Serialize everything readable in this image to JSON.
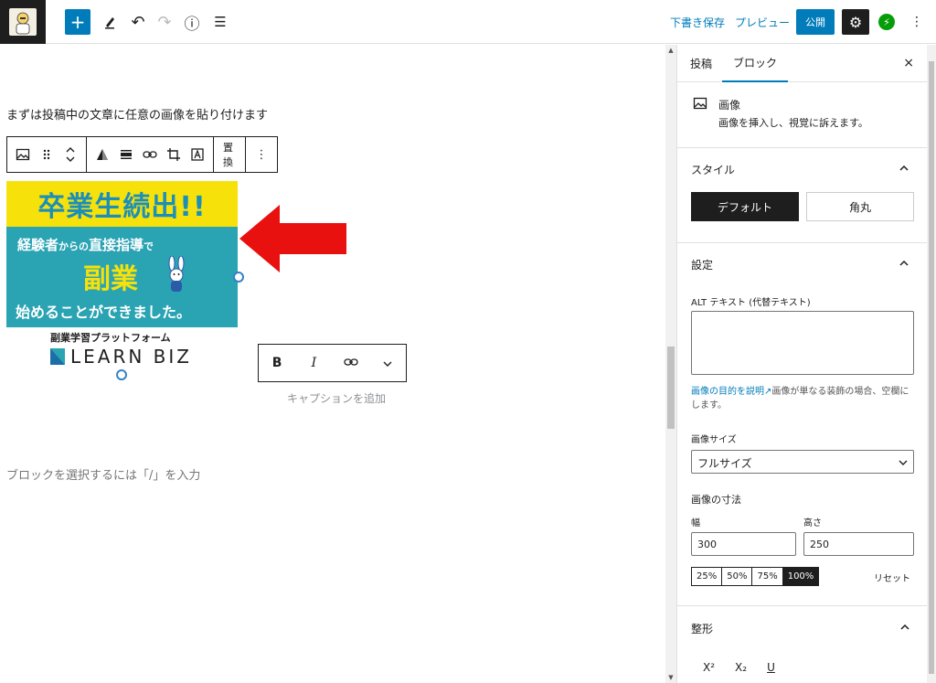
{
  "topbar": {
    "draft_save": "下書き保存",
    "preview": "プレビュー",
    "publish": "公開",
    "inserter_symbol": "+",
    "undo_symbol": "↶",
    "redo_symbol": "↷",
    "info_symbol": "ⓘ",
    "outline_symbol": "☰",
    "more_symbol": "⋮",
    "gear_symbol": "⚙",
    "jetpack_symbol": "⚡"
  },
  "editor": {
    "paragraph": "まずは投稿中の文章に任意の画像を貼り付けます",
    "replace_label": "置換",
    "caption_placeholder": "キャプションを追加",
    "appender_placeholder": "ブロックを選択するには「/」を入力",
    "format": {
      "bold": "B",
      "italic": "I",
      "link": "⊝",
      "more": "⌄"
    },
    "banner": {
      "headline": "卒業生続出!!",
      "line1_a": "経験者",
      "line1_b": "からの",
      "line1_c": "直接指導",
      "line1_d": "で",
      "line2": "副業",
      "line3": "始めることができました。",
      "sub": "副業学習プラットフォーム",
      "brand": "LEARN BIZ"
    }
  },
  "sidebar": {
    "tab_post": "投稿",
    "tab_block": "ブロック",
    "close": "×",
    "block_title": "画像",
    "block_desc": "画像を挿入し、視覚に訴えます。",
    "styles_title": "スタイル",
    "style_default": "デフォルト",
    "style_rounded": "角丸",
    "settings_title": "設定",
    "alt_label": "ALT テキスト (代替テキスト)",
    "help_link": "画像の目的を説明",
    "help_text": "画像が単なる装飾の場合、空欄にします。",
    "size_label": "画像サイズ",
    "size_value": "フルサイズ",
    "dims_label": "画像の寸法",
    "width_label": "幅",
    "height_label": "高さ",
    "width_value": "300",
    "height_value": "250",
    "pct": [
      "25%",
      "50%",
      "75%",
      "100%"
    ],
    "reset": "リセット",
    "typo_title": "整形",
    "sup": "X²",
    "sub": "X₂",
    "underline": "U"
  },
  "colors": {
    "accent": "#007cba",
    "dark": "#1e1e1e",
    "arrow": "#e8110f",
    "banner_yellow": "#f6e20a",
    "banner_teal": "#2aa3b3"
  }
}
